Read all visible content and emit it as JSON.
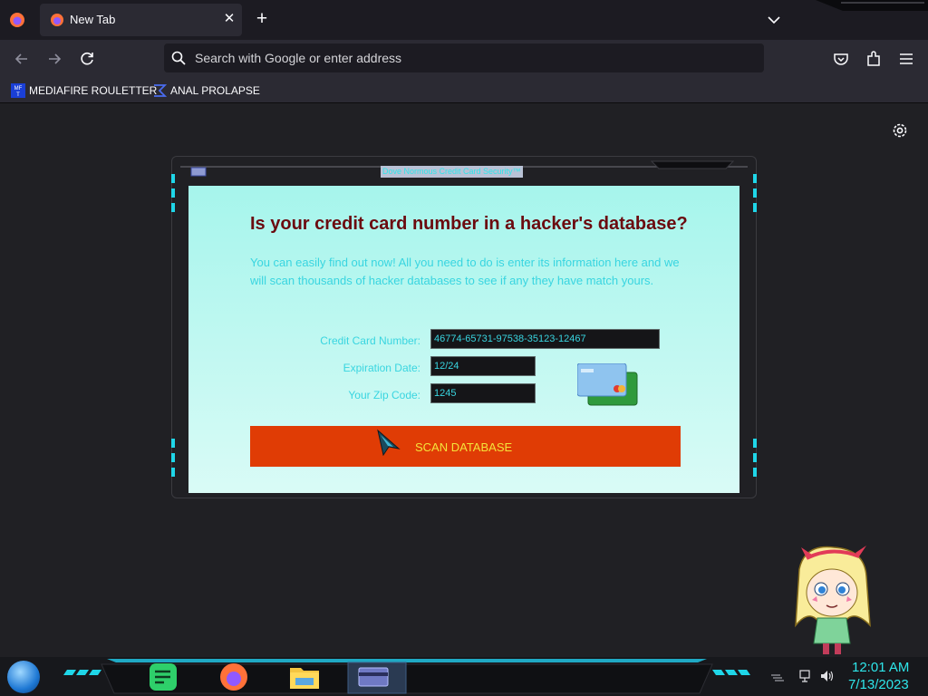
{
  "browser": {
    "tab_title": "New Tab",
    "url_placeholder": "Search with Google or enter address",
    "bookmarks": [
      {
        "label": "MEDIAFIRE ROULETTER",
        "icon": "mediafire-icon"
      },
      {
        "label": "ANAL PROLAPSE",
        "icon": "sigma-icon"
      }
    ]
  },
  "window": {
    "title": "Dove Normous Credit Card Security™"
  },
  "page": {
    "headline": "Is your credit card number in a hacker's database?",
    "intro": "You can easily find out now! All you need to do is enter its information here and we will scan thousands of hacker databases to see if any they have match yours.",
    "card_number_label": "Credit Card Number:",
    "card_number_value": "46774-65731-97538-35123-12467",
    "expiration_label": "Expiration Date:",
    "expiration_value": "12/24",
    "zip_label": "Your Zip Code:",
    "zip_value": "1245",
    "scan_button_label": "SCAN DATABASE"
  },
  "taskbar": {
    "time": "12:01 AM",
    "date": "7/13/2023",
    "apps": [
      "notes-icon",
      "firefox-icon",
      "file-explorer-icon",
      "credit-card-app-icon"
    ]
  },
  "colors": {
    "accent_cyan": "#2ee6ea",
    "button_orange": "#e03c05",
    "headline_maroon": "#6b0a0f"
  }
}
